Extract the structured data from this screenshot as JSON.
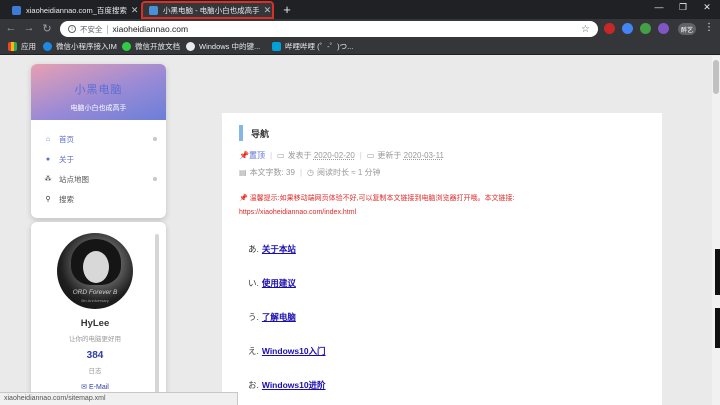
{
  "tabs": [
    {
      "title": "xiaoheidiannao.com_百度搜索"
    },
    {
      "title": "小黑电脑 - 电脑小白也成高手"
    }
  ],
  "window_controls": {
    "minimize": "—",
    "maximize": "❐",
    "close": "✕"
  },
  "omnibox": {
    "security_label": "不安全",
    "url": "xiaoheidiannao.com"
  },
  "profile_label": "醉艺",
  "bookmarks": [
    {
      "label": "应用"
    },
    {
      "label": "微信小程序接入IM"
    },
    {
      "label": "微信开放文档"
    },
    {
      "label": "Windows 中的键..."
    },
    {
      "label": "哔哩哔哩 (゜-゜)つ..."
    }
  ],
  "sidebar": {
    "brand_title": "小黑电脑",
    "brand_subtitle": "电脑小白也成高手",
    "nav": [
      {
        "label": "首页"
      },
      {
        "label": "关于"
      },
      {
        "label": "站点地图"
      },
      {
        "label": "搜索"
      }
    ],
    "author": {
      "name": "HyLee",
      "description": "让你的电脑更好用",
      "post_count": "384",
      "post_label": "日志",
      "email_label": "E-Mail",
      "avatar_caption": "ORD Forever B",
      "avatar_caption2": "5th Anniversary"
    }
  },
  "post": {
    "title": "导航",
    "pinned_label": "置顶",
    "published_label": "发表于",
    "published_date": "2020-02-20",
    "updated_label": "更新于",
    "updated_date": "2020-03-11",
    "wordcount_label": "本文字数:",
    "wordcount": "39",
    "readtime_label": "阅读时长 ≈",
    "readtime": "1 分钟",
    "tip": "温馨提示:如果移动端网页体验不好,可以复制本文链接到电脑浏览器打开哦。本文链接:",
    "tip_url": "https://xiaoheidiannao.com/index.html",
    "toc": [
      {
        "num": "あ.",
        "label": "关于本站"
      },
      {
        "num": "い.",
        "label": "使用建议"
      },
      {
        "num": "う.",
        "label": "了解电脑"
      },
      {
        "num": "え.",
        "label": "Windows10入门"
      },
      {
        "num": "お.",
        "label": "Windows10进阶"
      }
    ]
  },
  "status_bar_url": "xiaoheidiannao.com/sitemap.xml",
  "colors": {
    "accent": "#5b6ed0",
    "link": "#1a0dab",
    "warning": "#e02a2a",
    "title_bar": "#84b7e3"
  }
}
